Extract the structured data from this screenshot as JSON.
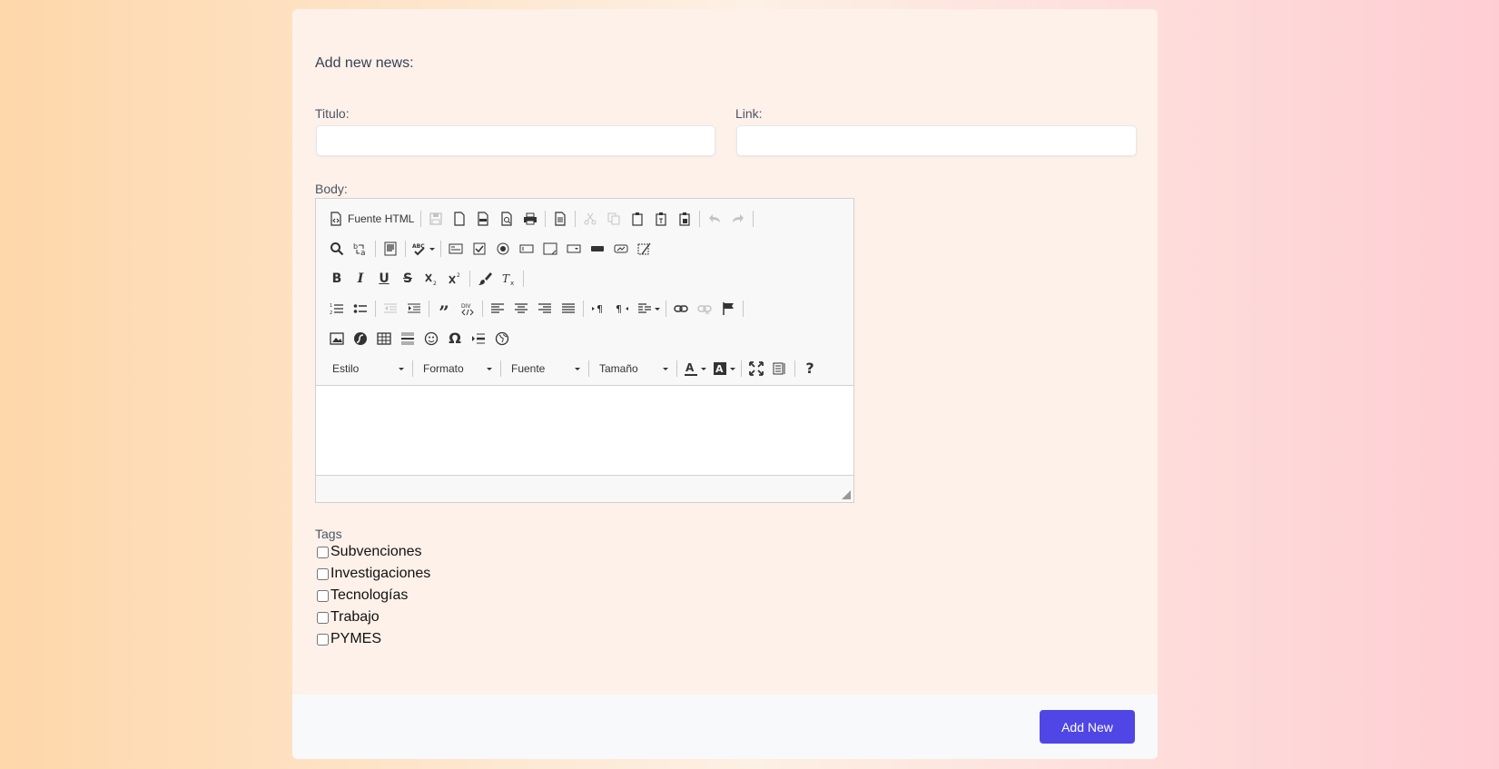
{
  "form": {
    "heading": "Add new news:",
    "titulo_label": "Titulo:",
    "titulo_value": "",
    "link_label": "Link:",
    "link_value": "",
    "body_label": "Body:"
  },
  "editor": {
    "source_label": "Fuente HTML",
    "combos": {
      "estilo": "Estilo",
      "formato": "Formato",
      "fuente": "Fuente",
      "tamano": "Tamaño"
    },
    "help": "?"
  },
  "tags": {
    "title": "Tags",
    "items": [
      {
        "label": "Subvenciones",
        "checked": false
      },
      {
        "label": "Investigaciones",
        "checked": false
      },
      {
        "label": "Tecnologías",
        "checked": false
      },
      {
        "label": "Trabajo",
        "checked": false
      },
      {
        "label": "PYMES",
        "checked": false
      }
    ]
  },
  "footer": {
    "submit_label": "Add New"
  },
  "colors": {
    "button": "#4f46e5",
    "card": "#fdf1ea",
    "footer": "#f8f9fb"
  }
}
